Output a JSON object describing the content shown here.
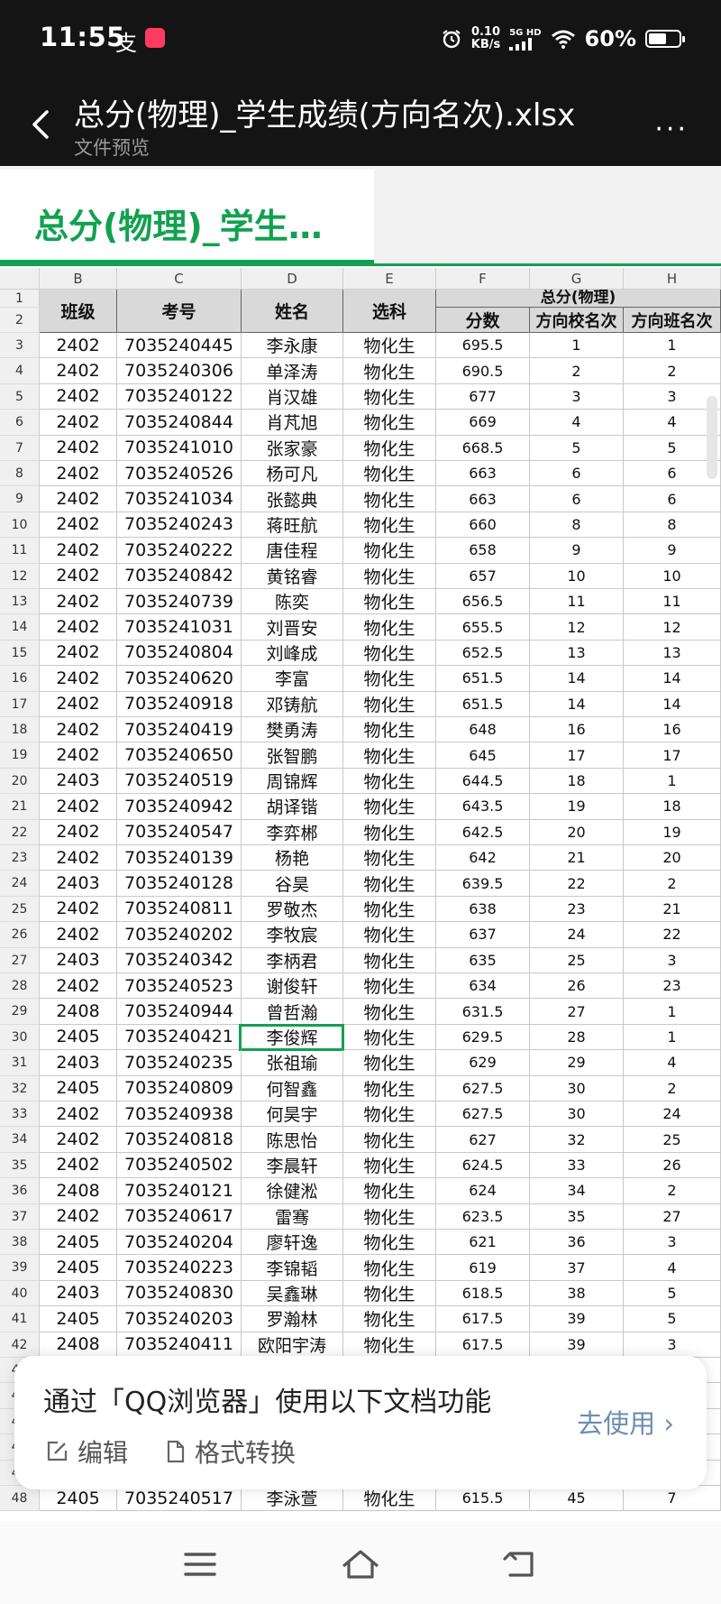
{
  "status_bar": {
    "time": "11:55",
    "notif_char": "支",
    "net_speed_value": "0.10",
    "net_speed_unit": "KB/s",
    "network_label": "5G HD",
    "battery_text": "60%",
    "battery_level": 0.6
  },
  "title_bar": {
    "title": "总分(物理)_学生成绩(方向名次).xlsx",
    "subtitle": "文件预览",
    "more": "···"
  },
  "sheet_tab": {
    "label": "总分(物理)_学生…"
  },
  "columns": [
    "B",
    "C",
    "D",
    "E",
    "F",
    "G",
    "H"
  ],
  "header": {
    "class": "班级",
    "exam_no": "考号",
    "name": "姓名",
    "subjects": "选科",
    "group": "总分(物理)",
    "score": "分数",
    "school_rank": "方向校名次",
    "class_rank": "方向班名次"
  },
  "header_row_numbers": [
    "1",
    "2"
  ],
  "rows": [
    {
      "n": "3",
      "b": "2402",
      "c": "7035240445",
      "d": "李永康",
      "e": "物化生",
      "f": "695.5",
      "g": "1",
      "h": "1"
    },
    {
      "n": "4",
      "b": "2402",
      "c": "7035240306",
      "d": "单泽涛",
      "e": "物化生",
      "f": "690.5",
      "g": "2",
      "h": "2"
    },
    {
      "n": "5",
      "b": "2402",
      "c": "7035240122",
      "d": "肖汉雄",
      "e": "物化生",
      "f": "677",
      "g": "3",
      "h": "3"
    },
    {
      "n": "6",
      "b": "2402",
      "c": "7035240844",
      "d": "肖芃旭",
      "e": "物化生",
      "f": "669",
      "g": "4",
      "h": "4"
    },
    {
      "n": "7",
      "b": "2402",
      "c": "7035241010",
      "d": "张家豪",
      "e": "物化生",
      "f": "668.5",
      "g": "5",
      "h": "5"
    },
    {
      "n": "8",
      "b": "2402",
      "c": "7035240526",
      "d": "杨可凡",
      "e": "物化生",
      "f": "663",
      "g": "6",
      "h": "6"
    },
    {
      "n": "9",
      "b": "2402",
      "c": "7035241034",
      "d": "张懿典",
      "e": "物化生",
      "f": "663",
      "g": "6",
      "h": "6"
    },
    {
      "n": "10",
      "b": "2402",
      "c": "7035240243",
      "d": "蒋旺航",
      "e": "物化生",
      "f": "660",
      "g": "8",
      "h": "8"
    },
    {
      "n": "11",
      "b": "2402",
      "c": "7035240222",
      "d": "唐佳程",
      "e": "物化生",
      "f": "658",
      "g": "9",
      "h": "9"
    },
    {
      "n": "12",
      "b": "2402",
      "c": "7035240842",
      "d": "黄铭睿",
      "e": "物化生",
      "f": "657",
      "g": "10",
      "h": "10"
    },
    {
      "n": "13",
      "b": "2402",
      "c": "7035240739",
      "d": "陈奕",
      "e": "物化生",
      "f": "656.5",
      "g": "11",
      "h": "11"
    },
    {
      "n": "14",
      "b": "2402",
      "c": "7035241031",
      "d": "刘晋安",
      "e": "物化生",
      "f": "655.5",
      "g": "12",
      "h": "12"
    },
    {
      "n": "15",
      "b": "2402",
      "c": "7035240804",
      "d": "刘峰成",
      "e": "物化生",
      "f": "652.5",
      "g": "13",
      "h": "13"
    },
    {
      "n": "16",
      "b": "2402",
      "c": "7035240620",
      "d": "李富",
      "e": "物化生",
      "f": "651.5",
      "g": "14",
      "h": "14"
    },
    {
      "n": "17",
      "b": "2402",
      "c": "7035240918",
      "d": "邓铸航",
      "e": "物化生",
      "f": "651.5",
      "g": "14",
      "h": "14"
    },
    {
      "n": "18",
      "b": "2402",
      "c": "7035240419",
      "d": "樊勇涛",
      "e": "物化生",
      "f": "648",
      "g": "16",
      "h": "16"
    },
    {
      "n": "19",
      "b": "2402",
      "c": "7035240650",
      "d": "张智鹏",
      "e": "物化生",
      "f": "645",
      "g": "17",
      "h": "17"
    },
    {
      "n": "20",
      "b": "2403",
      "c": "7035240519",
      "d": "周锦辉",
      "e": "物化生",
      "f": "644.5",
      "g": "18",
      "h": "1"
    },
    {
      "n": "21",
      "b": "2402",
      "c": "7035240942",
      "d": "胡译锴",
      "e": "物化生",
      "f": "643.5",
      "g": "19",
      "h": "18"
    },
    {
      "n": "22",
      "b": "2402",
      "c": "7035240547",
      "d": "李弈郴",
      "e": "物化生",
      "f": "642.5",
      "g": "20",
      "h": "19"
    },
    {
      "n": "23",
      "b": "2402",
      "c": "7035240139",
      "d": "杨艳",
      "e": "物化生",
      "f": "642",
      "g": "21",
      "h": "20"
    },
    {
      "n": "24",
      "b": "2403",
      "c": "7035240128",
      "d": "谷昊",
      "e": "物化生",
      "f": "639.5",
      "g": "22",
      "h": "2"
    },
    {
      "n": "25",
      "b": "2402",
      "c": "7035240811",
      "d": "罗敬杰",
      "e": "物化生",
      "f": "638",
      "g": "23",
      "h": "21"
    },
    {
      "n": "26",
      "b": "2402",
      "c": "7035240202",
      "d": "李牧宸",
      "e": "物化生",
      "f": "637",
      "g": "24",
      "h": "22"
    },
    {
      "n": "27",
      "b": "2403",
      "c": "7035240342",
      "d": "李柄君",
      "e": "物化生",
      "f": "635",
      "g": "25",
      "h": "3"
    },
    {
      "n": "28",
      "b": "2402",
      "c": "7035240523",
      "d": "谢俊轩",
      "e": "物化生",
      "f": "634",
      "g": "26",
      "h": "23"
    },
    {
      "n": "29",
      "b": "2408",
      "c": "7035240944",
      "d": "曾哲瀚",
      "e": "物化生",
      "f": "631.5",
      "g": "27",
      "h": "1"
    },
    {
      "n": "30",
      "b": "2405",
      "c": "7035240421",
      "d": "李俊辉",
      "e": "物化生",
      "f": "629.5",
      "g": "28",
      "h": "1"
    },
    {
      "n": "31",
      "b": "2403",
      "c": "7035240235",
      "d": "张祖瑜",
      "e": "物化生",
      "f": "629",
      "g": "29",
      "h": "4"
    },
    {
      "n": "32",
      "b": "2405",
      "c": "7035240809",
      "d": "何智鑫",
      "e": "物化生",
      "f": "627.5",
      "g": "30",
      "h": "2"
    },
    {
      "n": "33",
      "b": "2402",
      "c": "7035240938",
      "d": "何昊宇",
      "e": "物化生",
      "f": "627.5",
      "g": "30",
      "h": "24"
    },
    {
      "n": "34",
      "b": "2402",
      "c": "7035240818",
      "d": "陈思怡",
      "e": "物化生",
      "f": "627",
      "g": "32",
      "h": "25"
    },
    {
      "n": "35",
      "b": "2402",
      "c": "7035240502",
      "d": "李晨轩",
      "e": "物化生",
      "f": "624.5",
      "g": "33",
      "h": "26"
    },
    {
      "n": "36",
      "b": "2408",
      "c": "7035240121",
      "d": "徐健淞",
      "e": "物化生",
      "f": "624",
      "g": "34",
      "h": "2"
    },
    {
      "n": "37",
      "b": "2402",
      "c": "7035240617",
      "d": "雷骞",
      "e": "物化生",
      "f": "623.5",
      "g": "35",
      "h": "27"
    },
    {
      "n": "38",
      "b": "2405",
      "c": "7035240204",
      "d": "廖轩逸",
      "e": "物化生",
      "f": "621",
      "g": "36",
      "h": "3"
    },
    {
      "n": "39",
      "b": "2405",
      "c": "7035240223",
      "d": "李锦韬",
      "e": "物化生",
      "f": "619",
      "g": "37",
      "h": "4"
    },
    {
      "n": "40",
      "b": "2403",
      "c": "7035240830",
      "d": "吴鑫琳",
      "e": "物化生",
      "f": "618.5",
      "g": "38",
      "h": "5"
    },
    {
      "n": "41",
      "b": "2405",
      "c": "7035240203",
      "d": "罗瀚林",
      "e": "物化生",
      "f": "617.5",
      "g": "39",
      "h": "5"
    },
    {
      "n": "42",
      "b": "2408",
      "c": "7035240411",
      "d": "欧阳宇涛",
      "e": "物化生",
      "f": "617.5",
      "g": "39",
      "h": "3"
    },
    {
      "n": "43",
      "b": "",
      "c": "",
      "d": "",
      "e": "",
      "f": "",
      "g": "",
      "h": ""
    },
    {
      "n": "44",
      "b": "",
      "c": "",
      "d": "",
      "e": "",
      "f": "",
      "g": "",
      "h": ""
    },
    {
      "n": "45",
      "b": "",
      "c": "",
      "d": "",
      "e": "",
      "f": "",
      "g": "",
      "h": ""
    },
    {
      "n": "46",
      "b": "",
      "c": "",
      "d": "",
      "e": "",
      "f": "",
      "g": "",
      "h": ""
    },
    {
      "n": "47",
      "b": "",
      "c": "",
      "d": "",
      "e": "",
      "f": "",
      "g": "",
      "h": ""
    },
    {
      "n": "48",
      "b": "2405",
      "c": "7035240517",
      "d": "李泳萱",
      "e": "物化生",
      "f": "615.5",
      "g": "45",
      "h": "7"
    }
  ],
  "selected_row": "30",
  "banner": {
    "title": "通过「QQ浏览器」使用以下文档功能",
    "edit": "编辑",
    "convert": "格式转换",
    "go": "去使用 ›"
  },
  "colors": {
    "accent": "#12a150",
    "header_fill": "#d9d9d9",
    "status_bg": "#141414"
  }
}
